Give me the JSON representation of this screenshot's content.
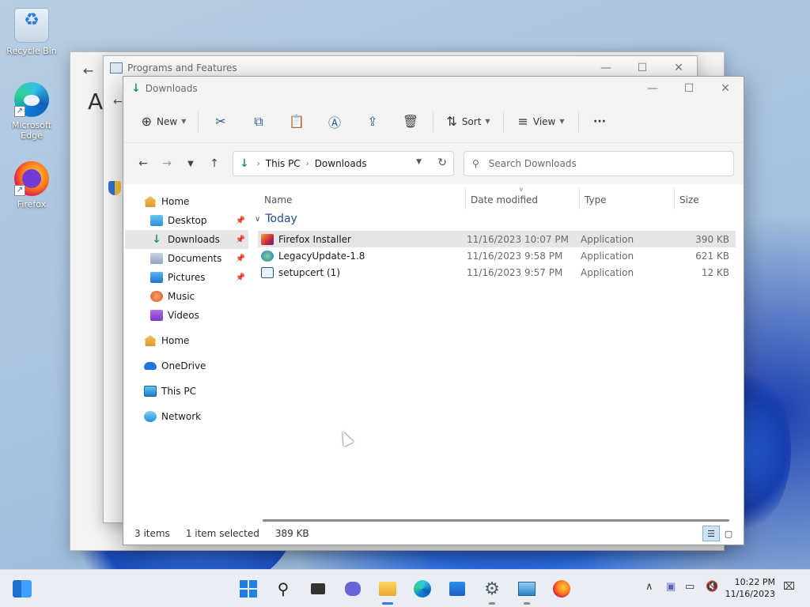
{
  "desktop": {
    "icons": [
      {
        "label": "Recycle Bin"
      },
      {
        "label": "Microsoft Edge"
      },
      {
        "label": "Firefox"
      }
    ]
  },
  "back_windows": {
    "back_heading": "A",
    "programs_title": "Programs and Features"
  },
  "window": {
    "title": "Downloads",
    "toolbar": {
      "new_label": "New",
      "sort_label": "Sort",
      "view_label": "View",
      "more_label": "···"
    },
    "address": {
      "crumbs": [
        "This PC",
        "Downloads"
      ]
    },
    "search": {
      "placeholder": "Search Downloads"
    },
    "nav": [
      {
        "label": "Home",
        "icon": "home-icon",
        "pinned": false,
        "selected": false
      },
      {
        "label": "Desktop",
        "icon": "desktop-folder-icon",
        "pinned": true,
        "selected": false
      },
      {
        "label": "Downloads",
        "icon": "downloads-folder-icon",
        "pinned": true,
        "selected": true
      },
      {
        "label": "Documents",
        "icon": "documents-folder-icon",
        "pinned": true,
        "selected": false
      },
      {
        "label": "Pictures",
        "icon": "pictures-folder-icon",
        "pinned": true,
        "selected": false
      },
      {
        "label": "Music",
        "icon": "music-folder-icon",
        "pinned": false,
        "selected": false
      },
      {
        "label": "Videos",
        "icon": "videos-folder-icon",
        "pinned": false,
        "selected": false
      },
      {
        "label": "Home",
        "icon": "home-icon",
        "pinned": false,
        "selected": false
      },
      {
        "label": "OneDrive",
        "icon": "onedrive-icon",
        "pinned": false,
        "selected": false
      },
      {
        "label": "This PC",
        "icon": "this-pc-icon",
        "pinned": false,
        "selected": false
      },
      {
        "label": "Network",
        "icon": "network-icon",
        "pinned": false,
        "selected": false
      }
    ],
    "columns": {
      "name": "Name",
      "date": "Date modified",
      "type": "Type",
      "size": "Size"
    },
    "group": "Today",
    "files": [
      {
        "name": "Firefox Installer",
        "date": "11/16/2023 10:07 PM",
        "type": "Application",
        "size": "390 KB",
        "selected": true,
        "icon": "firefox-installer-icon"
      },
      {
        "name": "LegacyUpdate-1.8",
        "date": "11/16/2023 9:58 PM",
        "type": "Application",
        "size": "621 KB",
        "selected": false,
        "icon": "legacy-update-icon"
      },
      {
        "name": "setupcert (1)",
        "date": "11/16/2023 9:57 PM",
        "type": "Application",
        "size": "12 KB",
        "selected": false,
        "icon": "setupcert-icon"
      }
    ],
    "status": {
      "count": "3 items",
      "selection": "1 item selected",
      "selection_size": "389 KB"
    }
  },
  "taskbar": {
    "time": "10:22 PM",
    "date": "11/16/2023"
  },
  "colors": {
    "accent": "#0067c0",
    "downloads_green": "#1a9b5a",
    "selection": "#e5e5e5"
  }
}
